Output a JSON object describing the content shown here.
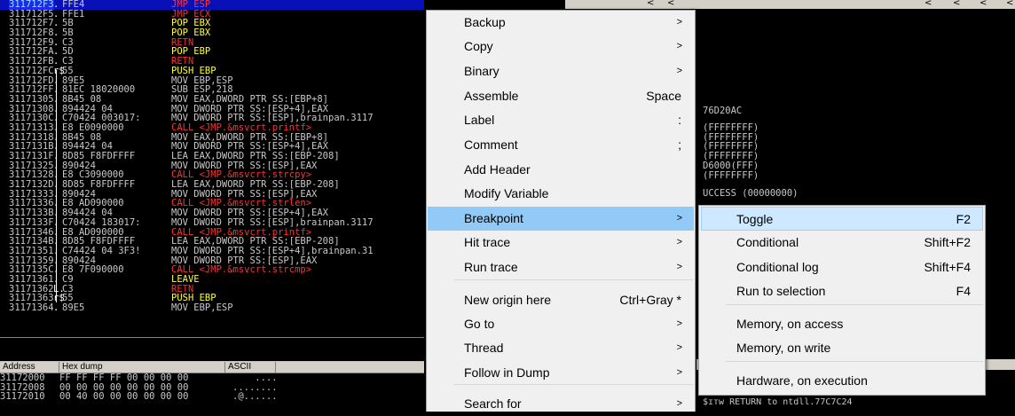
{
  "disasm": {
    "rows": [
      {
        "addr": "311712F3",
        "mark": ".",
        "hex": "FFE4",
        "cmd": "JMP ESP",
        "cls": "t-jmp",
        "sel": true
      },
      {
        "addr": "311712F5",
        "mark": ".",
        "hex": "FFE1",
        "cmd": "JMP ECX",
        "cls": "t-jmp"
      },
      {
        "addr": "311712F7",
        "mark": ".",
        "hex": "5B",
        "cmd": "POP EBX",
        "cls": "t-stack"
      },
      {
        "addr": "311712F8",
        "mark": ".",
        "hex": "5B",
        "cmd": "POP EBX",
        "cls": "t-stack"
      },
      {
        "addr": "311712F9",
        "mark": ".",
        "hex": "C3",
        "cmd": "RETN",
        "cls": "t-ret"
      },
      {
        "addr": "311712FA",
        "mark": ".",
        "hex": "5D",
        "cmd": "POP EBP",
        "cls": "t-stack"
      },
      {
        "addr": "311712FB",
        "mark": ".",
        "hex": "C3",
        "cmd": "RETN",
        "cls": "t-ret"
      },
      {
        "addr": "311712FC",
        "mark": "r$",
        "hex": "55",
        "cmd": "PUSH EBP",
        "cls": "t-stack"
      },
      {
        "addr": "311712FD",
        "mark": ".",
        "hex": "89E5",
        "cmd": "MOV EBP,ESP",
        "cls": "t-norm"
      },
      {
        "addr": "311712FF",
        "mark": ".",
        "hex": "81EC 18020000",
        "cmd": "SUB ESP,218",
        "cls": "t-norm"
      },
      {
        "addr": "31171305",
        "mark": ".",
        "hex": "8B45 08",
        "cmd": "MOV EAX,DWORD PTR SS:[EBP+8]",
        "cls": "t-norm"
      },
      {
        "addr": "31171308",
        "mark": ".",
        "hex": "894424 04",
        "cmd": "MOV DWORD PTR SS:[ESP+4],EAX",
        "cls": "t-norm"
      },
      {
        "addr": "3117130C",
        "mark": ".",
        "hex": "C70424 003017:",
        "cmd": "MOV DWORD PTR SS:[ESP],brainpan.3117",
        "cls": "t-norm"
      },
      {
        "addr": "31171313",
        "mark": ".",
        "hex": "E8 E0090000",
        "cmd": "CALL <JMP.&msvcrt.printf>",
        "cls": "t-call"
      },
      {
        "addr": "31171318",
        "mark": ".",
        "hex": "8B45 08",
        "cmd": "MOV EAX,DWORD PTR SS:[EBP+8]",
        "cls": "t-norm"
      },
      {
        "addr": "3117131B",
        "mark": ".",
        "hex": "894424 04",
        "cmd": "MOV DWORD PTR SS:[ESP+4],EAX",
        "cls": "t-norm"
      },
      {
        "addr": "3117131F",
        "mark": ".",
        "hex": "8D85 F8FDFFFF",
        "cmd": "LEA EAX,DWORD PTR SS:[EBP-208]",
        "cls": "t-lea"
      },
      {
        "addr": "31171325",
        "mark": ".",
        "hex": "890424",
        "cmd": "MOV DWORD PTR SS:[ESP],EAX",
        "cls": "t-norm"
      },
      {
        "addr": "31171328",
        "mark": ".",
        "hex": "E8 C3090000",
        "cmd": "CALL <JMP.&msvcrt.strcpy>",
        "cls": "t-call"
      },
      {
        "addr": "3117132D",
        "mark": ".",
        "hex": "8D85 F8FDFFFF",
        "cmd": "LEA EAX,DWORD PTR SS:[EBP-208]",
        "cls": "t-lea"
      },
      {
        "addr": "31171333",
        "mark": ".",
        "hex": "890424",
        "cmd": "MOV DWORD PTR SS:[ESP],EAX",
        "cls": "t-norm"
      },
      {
        "addr": "31171336",
        "mark": ".",
        "hex": "E8 AD090000",
        "cmd": "CALL <JMP.&msvcrt.strlen>",
        "cls": "t-call"
      },
      {
        "addr": "3117133B",
        "mark": ".",
        "hex": "894424 04",
        "cmd": "MOV DWORD PTR SS:[ESP+4],EAX",
        "cls": "t-norm"
      },
      {
        "addr": "3117133F",
        "mark": ".",
        "hex": "C70424 183017:",
        "cmd": "MOV DWORD PTR SS:[ESP],brainpan.3117",
        "cls": "t-norm"
      },
      {
        "addr": "31171346",
        "mark": ".",
        "hex": "E8 AD090000",
        "cmd": "CALL <JMP.&msvcrt.printf>",
        "cls": "t-call"
      },
      {
        "addr": "3117134B",
        "mark": ".",
        "hex": "8D85 F8FDFFFF",
        "cmd": "LEA EAX,DWORD PTR SS:[EBP-208]",
        "cls": "t-lea"
      },
      {
        "addr": "31171351",
        "mark": ".",
        "hex": "C74424 04 3F3!",
        "cmd": "MOV DWORD PTR SS:[ESP+4],brainpan.31",
        "cls": "t-norm"
      },
      {
        "addr": "31171359",
        "mark": ".",
        "hex": "890424",
        "cmd": "MOV DWORD PTR SS:[ESP],EAX",
        "cls": "t-norm"
      },
      {
        "addr": "3117135C",
        "mark": ".",
        "hex": "E8 7F090000",
        "cmd": "CALL <JMP.&msvcrt.strcmp>",
        "cls": "t-call"
      },
      {
        "addr": "31171361",
        "mark": ".",
        "hex": "C9",
        "cmd": "LEAVE",
        "cls": "t-stack"
      },
      {
        "addr": "31171362",
        "mark": "L.",
        "hex": "C3",
        "cmd": "RETN",
        "cls": "t-ret"
      },
      {
        "addr": "31171363",
        "mark": "r$",
        "hex": "55",
        "cmd": "PUSH EBP",
        "cls": "t-stack"
      },
      {
        "addr": "31171364",
        "mark": ".",
        "hex": "89E5",
        "cmd": "MOV EBP,ESP",
        "cls": "t-norm"
      }
    ]
  },
  "dump": {
    "headers": {
      "address": "Address",
      "hex": "Hex dump",
      "ascii": "ASCII"
    },
    "rows": [
      {
        "addr": "31172000",
        "hex": "FF FF FF FF 00 00 00 00",
        "ascii": "    ...."
      },
      {
        "addr": "31172008",
        "hex": "00 00 00 00 00 00 00 00",
        "ascii": "........"
      },
      {
        "addr": "31172010",
        "hex": "00 40 00 00 00 00 00 00",
        "ascii": ".@......"
      }
    ]
  },
  "registers": {
    "lines": [
      {
        "text": "76D20AC"
      },
      {
        "text": "(FFFFFFFF)"
      },
      {
        "text": "(FFFFFFFF)"
      },
      {
        "text": "(FFFFFFFF)"
      },
      {
        "text": "(FFFFFFFF)"
      },
      {
        "text": "D6000(FFF)"
      },
      {
        "text": "(FFFFFFFF)"
      },
      {
        "text": "UCCESS (00000000)"
      }
    ],
    "stack_line": "$ɪᴛᴡ RETURN to ntdll.77C7C24"
  },
  "context_menu": {
    "items": [
      {
        "label": "Backup",
        "shortcut": "",
        "submenu": true
      },
      {
        "label": "Copy",
        "shortcut": "",
        "submenu": true
      },
      {
        "label": "Binary",
        "shortcut": "",
        "submenu": true
      },
      {
        "label": "Assemble",
        "shortcut": "Space",
        "submenu": false
      },
      {
        "label": "Label",
        "shortcut": ":",
        "submenu": false
      },
      {
        "label": "Comment",
        "shortcut": ";",
        "submenu": false
      },
      {
        "label": "Add Header",
        "shortcut": "",
        "submenu": false
      },
      {
        "label": "Modify Variable",
        "shortcut": "",
        "submenu": false
      },
      {
        "label": "Breakpoint",
        "shortcut": "",
        "submenu": true,
        "highlighted": true
      },
      {
        "label": "Hit trace",
        "shortcut": "",
        "submenu": true
      },
      {
        "label": "Run trace",
        "shortcut": "",
        "submenu": true
      },
      {
        "label": "New origin here",
        "shortcut": "Ctrl+Gray *",
        "submenu": false
      },
      {
        "label": "Go to",
        "shortcut": "",
        "submenu": true
      },
      {
        "label": "Thread",
        "shortcut": "",
        "submenu": true
      },
      {
        "label": "Follow in Dump",
        "shortcut": "",
        "submenu": true
      },
      {
        "label": "Search for",
        "shortcut": "",
        "submenu": true
      }
    ]
  },
  "breakpoint_menu": {
    "items": [
      {
        "label": "Toggle",
        "shortcut": "F2",
        "highlighted": true
      },
      {
        "label": "Conditional",
        "shortcut": "Shift+F2"
      },
      {
        "label": "Conditional log",
        "shortcut": "Shift+F4"
      },
      {
        "label": "Run to selection",
        "shortcut": "F4"
      },
      {
        "label": "Memory, on access",
        "shortcut": ""
      },
      {
        "label": "Memory, on write",
        "shortcut": ""
      },
      {
        "label": "Hardware, on execution",
        "shortcut": ""
      }
    ]
  },
  "arrow_glyph": "<",
  "submenu_glyph": ">"
}
